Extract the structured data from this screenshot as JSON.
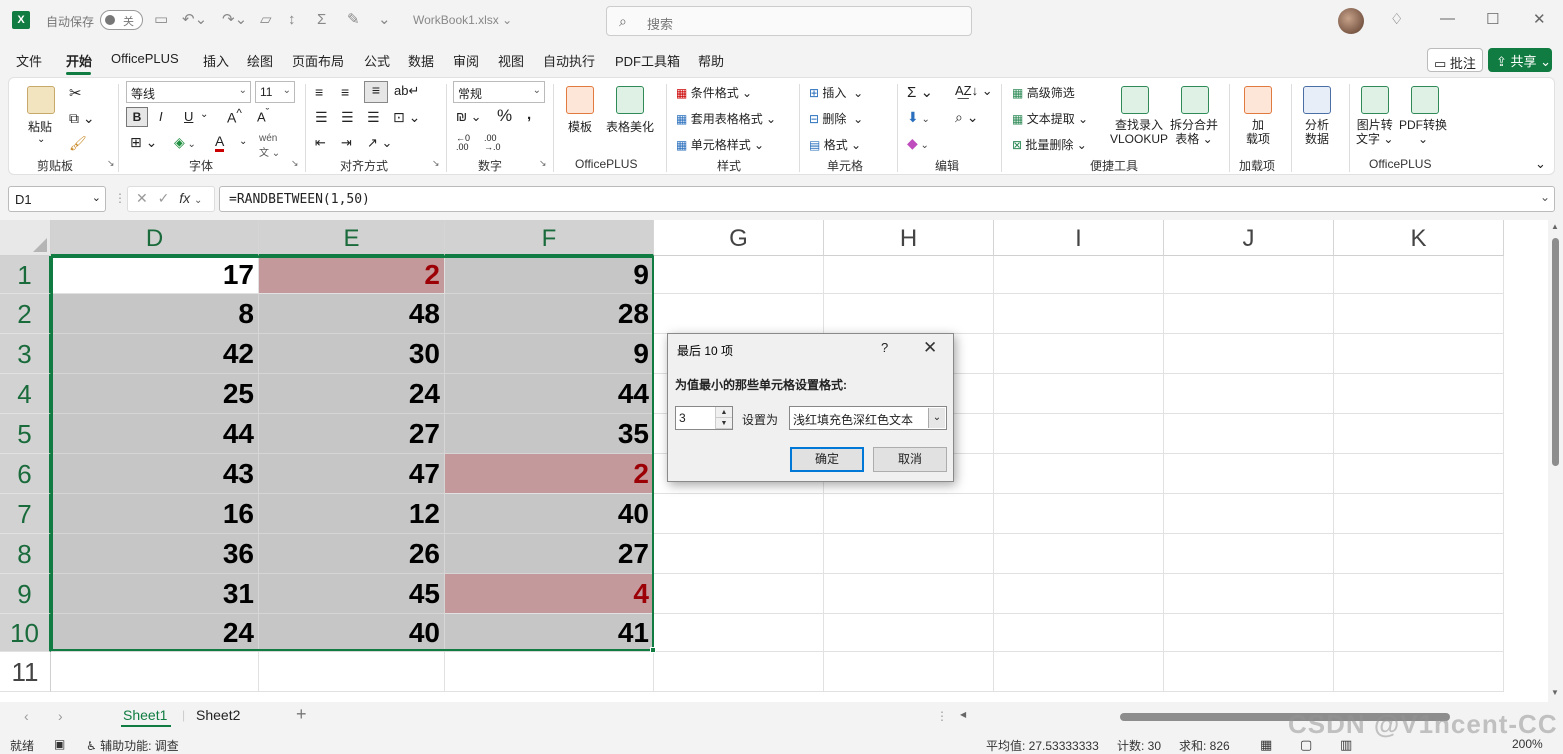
{
  "app": {
    "logo": "X",
    "autosave_label": "自动保存",
    "autosave_state": "关",
    "filename": "WorkBook1.xlsx ⌄",
    "search_placeholder": "搜索",
    "brand_color": "#107c41"
  },
  "tabs": [
    "文件",
    "开始",
    "OfficePLUS",
    "插入",
    "绘图",
    "页面布局",
    "公式",
    "数据",
    "审阅",
    "视图",
    "自动执行",
    "PDF工具箱",
    "帮助"
  ],
  "active_tab": "开始",
  "header_buttons": {
    "comment": "批注",
    "share": "共享"
  },
  "ribbon": {
    "clipboard": {
      "paste": "粘贴",
      "label": "剪贴板"
    },
    "font": {
      "name": "等线",
      "size": "11",
      "label": "字体",
      "bold": "B",
      "italic": "I",
      "underline": "U"
    },
    "alignment": {
      "label": "对齐方式"
    },
    "number": {
      "format": "常规",
      "label": "数字",
      "percent": "%"
    },
    "officeplus1": {
      "template": "模板",
      "beautify": "表格美化",
      "label": "OfficePLUS"
    },
    "styles": {
      "conditional": "条件格式",
      "table_format": "套用表格格式",
      "cell_styles": "单元格样式",
      "label": "样式"
    },
    "cells": {
      "insert": "插入",
      "delete": "删除",
      "format": "格式",
      "label": "单元格"
    },
    "editing": {
      "label": "编辑"
    },
    "tools": {
      "advanced_filter": "高级筛选",
      "text_extract": "文本提取",
      "batch_delete": "批量删除",
      "vlookup_line1": "查找录入",
      "vlookup_line2": "VLOOKUP",
      "split_line1": "拆分合并",
      "split_line2": "表格",
      "label": "便捷工具"
    },
    "addins": {
      "line1": "加",
      "line2": "载项",
      "label": "加载项"
    },
    "analyze": {
      "line1": "分析",
      "line2": "数据"
    },
    "officeplus2": {
      "img_line1": "图片转",
      "img_line2": "文字",
      "pdf_line1": "PDF转换",
      "label": "OfficePLUS"
    }
  },
  "formula_bar": {
    "name_box": "D1",
    "formula": "=RANDBETWEEN(1,50)",
    "fx": "fx"
  },
  "columns": [
    "D",
    "E",
    "F",
    "G",
    "H",
    "I",
    "J",
    "K"
  ],
  "rows": [
    "1",
    "2",
    "3",
    "4",
    "5",
    "6",
    "7",
    "8",
    "9",
    "10",
    "11"
  ],
  "cells": {
    "D": [
      17,
      8,
      42,
      25,
      44,
      43,
      16,
      36,
      31,
      24
    ],
    "E": [
      2,
      48,
      30,
      24,
      27,
      47,
      12,
      26,
      45,
      40
    ],
    "F": [
      9,
      28,
      9,
      44,
      35,
      2,
      40,
      27,
      4,
      41
    ]
  },
  "highlight": {
    "fill": "#c4999b",
    "text": "#9c0006",
    "selection_fill": "#c6c6c6"
  },
  "dialog": {
    "title": "最后 10 项",
    "help": "?",
    "prompt": "为值最小的那些单元格设置格式:",
    "count": "3",
    "set_as_label": "设置为",
    "format_option": "浅红填充色深红色文本",
    "ok": "确定",
    "cancel": "取消"
  },
  "sheets": [
    "Sheet1",
    "Sheet2"
  ],
  "status": {
    "ready": "就绪",
    "accessibility": "辅助功能: 调查",
    "average": "平均值: 27.53333333",
    "count": "计数: 30",
    "sum": "求和: 826",
    "zoom": "200%"
  },
  "watermark": "CSDN @V1ncent-CC"
}
